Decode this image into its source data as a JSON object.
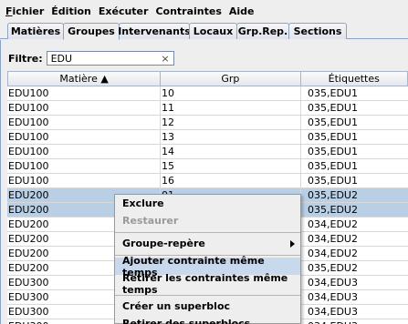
{
  "menu": {
    "items": [
      {
        "label_ul": "F",
        "label_rest": "ichier"
      },
      {
        "label_ul": "",
        "label_rest": "Édition"
      },
      {
        "label_ul": "",
        "label_rest": "Exécuter"
      },
      {
        "label_ul": "",
        "label_rest": "Contraintes"
      },
      {
        "label_ul": "",
        "label_rest": "Aide"
      }
    ]
  },
  "tabs": [
    "Matières",
    "Groupes",
    "Intervenants",
    "Locaux",
    "Grp.Rep.",
    "Sections"
  ],
  "active_tab": "Groupes",
  "filter": {
    "label": "Filtre:",
    "value": "EDU",
    "clear_glyph": "×"
  },
  "table": {
    "columns": [
      "Matière ▲",
      "Grp",
      "Étiquettes"
    ],
    "rows": [
      {
        "matiere": "EDU100",
        "grp": "10",
        "etiq": "035,EDU1",
        "selected": false
      },
      {
        "matiere": "EDU100",
        "grp": "11",
        "etiq": "035,EDU1",
        "selected": false
      },
      {
        "matiere": "EDU100",
        "grp": "12",
        "etiq": "035,EDU1",
        "selected": false
      },
      {
        "matiere": "EDU100",
        "grp": "13",
        "etiq": "035,EDU1",
        "selected": false
      },
      {
        "matiere": "EDU100",
        "grp": "14",
        "etiq": "035,EDU1",
        "selected": false
      },
      {
        "matiere": "EDU100",
        "grp": "15",
        "etiq": "035,EDU1",
        "selected": false
      },
      {
        "matiere": "EDU100",
        "grp": "16",
        "etiq": "035,EDU1",
        "selected": false
      },
      {
        "matiere": "EDU200",
        "grp": "01",
        "etiq": "035,EDU2",
        "selected": true
      },
      {
        "matiere": "EDU200",
        "grp": "",
        "etiq": "035,EDU2",
        "selected": true
      },
      {
        "matiere": "EDU200",
        "grp": "",
        "etiq": "034,EDU2",
        "selected": false
      },
      {
        "matiere": "EDU200",
        "grp": "",
        "etiq": "034,EDU2",
        "selected": false
      },
      {
        "matiere": "EDU200",
        "grp": "",
        "etiq": "034,EDU2",
        "selected": false
      },
      {
        "matiere": "EDU200",
        "grp": "",
        "etiq": "035,EDU2",
        "selected": false
      },
      {
        "matiere": "EDU300",
        "grp": "",
        "etiq": "034,EDU3",
        "selected": false
      },
      {
        "matiere": "EDU300",
        "grp": "",
        "etiq": "034,EDU3",
        "selected": false
      },
      {
        "matiere": "EDU300",
        "grp": "",
        "etiq": "034,EDU3",
        "selected": false
      },
      {
        "matiere": "EDU300",
        "grp": "",
        "etiq": "034,EDU3",
        "selected": false
      }
    ]
  },
  "context_menu": {
    "items": [
      {
        "label": "Exclure",
        "type": "item",
        "disabled": false,
        "submenu": false,
        "hover": false
      },
      {
        "label": "Restaurer",
        "type": "item",
        "disabled": true,
        "submenu": false,
        "hover": false
      },
      {
        "type": "sep"
      },
      {
        "label": "Groupe-repère",
        "type": "item",
        "disabled": false,
        "submenu": true,
        "hover": false
      },
      {
        "type": "sep"
      },
      {
        "label": "Ajouter contrainte même temps",
        "type": "item",
        "disabled": false,
        "submenu": false,
        "hover": true
      },
      {
        "label": "Retirer les contraintes même temps",
        "type": "item",
        "disabled": false,
        "submenu": false,
        "hover": false
      },
      {
        "type": "sep"
      },
      {
        "label": "Créer un superbloc",
        "type": "item",
        "disabled": false,
        "submenu": false,
        "hover": false
      },
      {
        "label": "Retirer des superblocs",
        "type": "item",
        "disabled": false,
        "submenu": false,
        "hover": false
      }
    ]
  }
}
